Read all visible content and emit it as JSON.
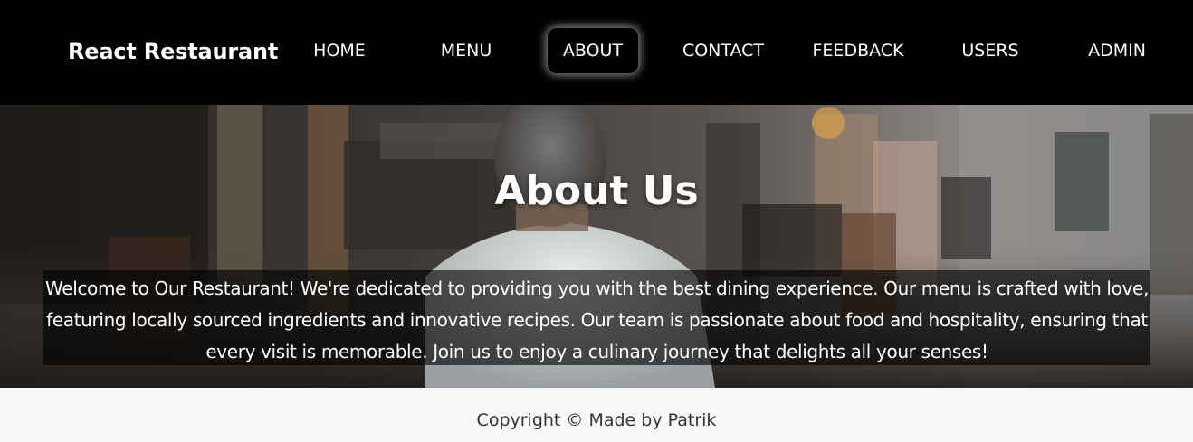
{
  "navbar": {
    "brand": "React Restaurant",
    "links": [
      {
        "label": "HOME"
      },
      {
        "label": "MENU"
      },
      {
        "label": "ABOUT",
        "active": true
      },
      {
        "label": "CONTACT"
      },
      {
        "label": "FEEDBACK"
      },
      {
        "label": "USERS"
      },
      {
        "label": "ADMIN"
      }
    ]
  },
  "hero": {
    "title": "About Us",
    "lines": [
      "Welcome to Our Restaurant! We're dedicated to providing you with the best dining experience. Our menu is crafted with love,",
      "featuring locally sourced ingredients and innovative recipes. Our team is passionate about food and hospitality, ensuring that",
      "every visit is memorable. Join us to enjoy a culinary journey that delights all your senses!"
    ]
  },
  "footer": {
    "text": "Copyright © Made by Patrik"
  }
}
